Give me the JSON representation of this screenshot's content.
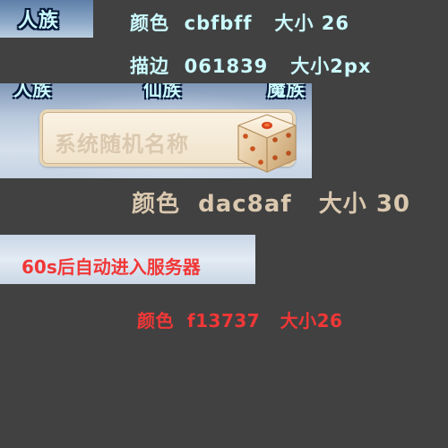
{
  "race_tab": {
    "label": "人族"
  },
  "notes": [
    "颜色  cbfbff   大小 26",
    "描边  061839   大小2px",
    "颜色  dac8af   大小 30",
    "颜色  f13737   大小26"
  ],
  "panel": {
    "headers": [
      "人族",
      "仙族",
      "魔族"
    ],
    "name_placeholder": "系统随机名称"
  },
  "countdown": {
    "text": "60s后自动进入服务器"
  },
  "colors": {
    "title_fill": "#cbfbff",
    "title_stroke": "#061839",
    "name_text": "#dac8af",
    "countdown_text": "#f13737"
  },
  "icons": {
    "dice": "dice-icon"
  }
}
